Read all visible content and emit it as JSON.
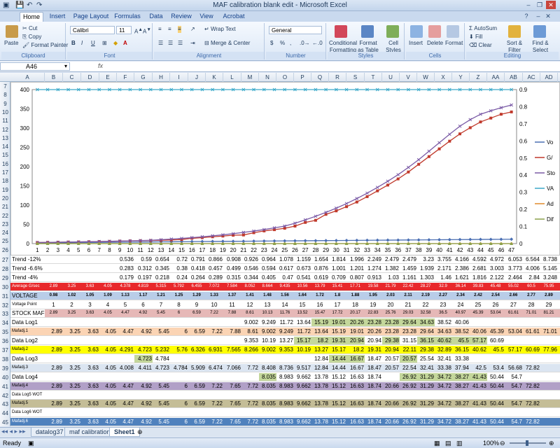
{
  "window": {
    "title": "MAF calibration blank edit - Microsoft Excel"
  },
  "tabs": [
    "Home",
    "Insert",
    "Page Layout",
    "Formulas",
    "Data",
    "Review",
    "View",
    "Acrobat"
  ],
  "ribbon": {
    "clipboard": {
      "paste": "Paste",
      "cut": "Cut",
      "copy": "Copy",
      "format_painter": "Format Painter",
      "label": "Clipboard"
    },
    "font": {
      "name": "Calibri",
      "size": "11",
      "label": "Font",
      "bold": "B",
      "italic": "I",
      "underline": "U"
    },
    "alignment": {
      "wrap": "Wrap Text",
      "merge": "Merge & Center",
      "label": "Alignment"
    },
    "number": {
      "format": "General",
      "currency": "$",
      "percent": "%",
      "comma": ",",
      "label": "Number"
    },
    "styles": {
      "conditional": "Conditional Formatting",
      "format_table": "Format as Table",
      "cell_styles": "Cell Styles",
      "label": "Styles"
    },
    "cells": {
      "insert": "Insert",
      "delete": "Delete",
      "format": "Format",
      "label": "Cells"
    },
    "editing": {
      "autosum": "AutoSum",
      "fill": "Fill",
      "clear": "Clear",
      "sort": "Sort & Filter",
      "find": "Find & Select",
      "label": "Editing"
    }
  },
  "formula_bar": {
    "name_box": "A46",
    "fx": "fx",
    "value": ""
  },
  "columns": [
    "A",
    "B",
    "C",
    "D",
    "E",
    "F",
    "G",
    "H",
    "I",
    "J",
    "K",
    "L",
    "M",
    "N",
    "O",
    "P",
    "Q",
    "R",
    "S",
    "T",
    "U",
    "V",
    "W",
    "X",
    "Y",
    "Z",
    "AA",
    "AB",
    "AC",
    "AD"
  ],
  "chart_rows": [
    "7",
    "8",
    "9",
    "10",
    "11",
    "12",
    "13",
    "14",
    "15",
    "16",
    "17",
    "18",
    "19",
    "20",
    "21",
    "22",
    "23",
    "24",
    "25",
    "26"
  ],
  "chart_data": {
    "type": "line",
    "x": [
      1,
      2,
      3,
      4,
      5,
      6,
      7,
      8,
      9,
      10,
      11,
      12,
      13,
      14,
      15,
      16,
      17,
      18,
      19,
      20,
      21,
      22,
      23,
      24,
      25,
      26,
      27,
      28,
      29,
      30,
      31,
      32,
      33,
      34,
      35,
      36,
      37,
      38,
      39,
      40,
      41,
      42,
      43,
      44,
      45,
      46,
      47
    ],
    "y_left_ticks": [
      "0",
      "50",
      "100",
      "150",
      "200",
      "250",
      "300",
      "350",
      "400"
    ],
    "y_right_ticks": [
      "0",
      "0.1",
      "0.2",
      "0.3",
      "0.4",
      "0.5",
      "0.6",
      "0.7",
      "0.8",
      "0.9"
    ],
    "ylim_left": [
      0,
      400
    ],
    "ylim_right": [
      0,
      0.9
    ],
    "series": [
      {
        "name": "Vo",
        "color": "#4a6fb3",
        "marker": "diamond",
        "axis": "left",
        "values": [
          1.5,
          1.8,
          2,
          2.2,
          2.5,
          2.8,
          3,
          3.2,
          3.5,
          3.7,
          4,
          4.2,
          4.5,
          4.7,
          5,
          5.2,
          5.4,
          5.6,
          5.8,
          6,
          6.2,
          6.4,
          6.6,
          6.8,
          7,
          7.2,
          7.4,
          7.6,
          7.8,
          8,
          8.2,
          8.4,
          8.6,
          8.8,
          9,
          9.2,
          9.4,
          9.6,
          9.8,
          10,
          10.2,
          10.4,
          10.6,
          10.8,
          11,
          11.2,
          11.4
        ]
      },
      {
        "name": "G/",
        "color": "#c0392b",
        "marker": "square",
        "axis": "left",
        "values": [
          2.89,
          3.25,
          3.63,
          4.05,
          4.378,
          4.819,
          5.315,
          5.792,
          6.455,
          7.072,
          7.584,
          8.052,
          8.664,
          9.435,
          10.56,
          13.79,
          15.41,
          17.71,
          19.58,
          21.79,
          22.42,
          28.27,
          32.9,
          36.14,
          39.83,
          45.48,
          55.02,
          60.5,
          75.95,
          85,
          96,
          108,
          122,
          137,
          152,
          168,
          186,
          206,
          226,
          246,
          266,
          285,
          301,
          316,
          326,
          336,
          342
        ]
      },
      {
        "name": "Sto",
        "color": "#7a5aa6",
        "marker": "x",
        "axis": "left",
        "values": [
          2.89,
          3.25,
          3.63,
          4.05,
          4.47,
          4.92,
          5.45,
          6,
          6.59,
          7.22,
          7.88,
          8.61,
          10.13,
          11.76,
          13.52,
          15.47,
          17.72,
          20.17,
          22.83,
          25.76,
          29.03,
          32.58,
          36.5,
          40.97,
          45.39,
          53.04,
          61.61,
          71.01,
          81.21,
          92,
          104,
          117,
          131,
          146,
          162,
          179,
          198,
          218,
          240,
          262,
          284,
          305,
          322,
          336,
          345,
          353,
          360
        ]
      },
      {
        "name": "VA",
        "color": "#3aa9c9",
        "marker": "x",
        "axis": "right",
        "values": [
          0.98,
          0.98,
          0.99,
          0.99,
          1.0,
          1.0,
          1.0,
          1.0,
          1.01,
          1.01,
          1.01,
          1.02,
          1.02,
          1.02,
          1.03,
          1.03,
          1.03,
          1.04,
          1.04,
          1.04,
          1.05,
          1.05,
          1.05,
          1.06,
          1.06,
          1.06,
          1.07,
          1.07,
          1.07,
          1.08,
          1.08,
          1.08,
          1.09,
          1.09,
          1.09,
          1.1,
          1.1,
          1.1,
          1.11,
          1.11,
          1.11,
          1.12,
          1.12,
          1.12,
          1.13,
          1.13,
          1.13
        ]
      },
      {
        "name": "Ad",
        "color": "#e08a2a",
        "marker": "circle",
        "axis": "left",
        "values": [
          0,
          0,
          0,
          0,
          0,
          0,
          0,
          0,
          0,
          0,
          0,
          0,
          0,
          0,
          0,
          0,
          0,
          0,
          0,
          0,
          0,
          0,
          0,
          0,
          0,
          0,
          0,
          0,
          0,
          0,
          0,
          0,
          0,
          0,
          0,
          0,
          0,
          0,
          0,
          0,
          0,
          0,
          0,
          0,
          0,
          0,
          0
        ]
      },
      {
        "name": "Dif",
        "color": "#8aa14a",
        "marker": "triangle",
        "axis": "left",
        "values": [
          0,
          0,
          0,
          0,
          0,
          0,
          0,
          0,
          0,
          0,
          0,
          0,
          0,
          0,
          0,
          0,
          0,
          0,
          0,
          0,
          0,
          0,
          0,
          0,
          0,
          0,
          0,
          0,
          0,
          0,
          0,
          0,
          0,
          0,
          0,
          0,
          0,
          0,
          0,
          0,
          0,
          0,
          0,
          0,
          0,
          0,
          0
        ]
      }
    ]
  },
  "grid": [
    {
      "row": "27",
      "label": "Trend -12%",
      "bg": "#ffffff",
      "label_bg": "#ffffff",
      "start": 5,
      "cells": [
        "0.536",
        "0.59",
        "0.654",
        "0.72",
        "0.791",
        "0.866",
        "0.908",
        "0.926",
        "0.964",
        "1.078",
        "1.159",
        "1.654",
        "1.814",
        "1.996",
        "2.249",
        "2.479",
        "2.479",
        "3.23",
        "3.755",
        "4.166",
        "4.592",
        "4.972",
        "6.053",
        "6.564",
        "8.738"
      ]
    },
    {
      "row": "28",
      "label": "Trend -6.6%",
      "bg": "#ffffff",
      "label_bg": "#ffffff",
      "start": 5,
      "cells": [
        "0.283",
        "0.312",
        "0.345",
        "0.38",
        "0.418",
        "0.457",
        "0.499",
        "0.546",
        "0.594",
        "0.617",
        "0.673",
        "0.876",
        "1.001",
        "1.201",
        "1.274",
        "1.382",
        "1.459",
        "1.939",
        "2.171",
        "2.386",
        "2.681",
        "3.003",
        "3.773",
        "4.006",
        "5.145"
      ]
    },
    {
      "row": "29",
      "label": "Trend -4%",
      "bg": "#ffffff",
      "label_bg": "#ffffff",
      "start": 5,
      "cells": [
        "0.179",
        "0.197",
        "0.218",
        "0.24",
        "0.264",
        "0.289",
        "0.315",
        "0.344",
        "0.405",
        "0.47",
        "0.541",
        "0.619",
        "0.709",
        "0.807",
        "0.913",
        "1.03",
        "1.161",
        "1.303",
        "1.46",
        "1.621",
        "1.816",
        "2.122",
        "2.464",
        "2.84",
        "3.248"
      ]
    },
    {
      "row": "30",
      "label": "Average G/sec",
      "bg": "#e8282b",
      "label_bg": "#e8282b",
      "color": "#ffffff",
      "start": 1,
      "small_label": true,
      "cells": [
        "2.89",
        "3.25",
        "3.63",
        "4.05",
        "4.378",
        "4.819",
        "5.315",
        "5.792",
        "6.455",
        "7.072",
        "7.584",
        "8.052",
        "8.664",
        "9.435",
        "10.56",
        "13.79",
        "15.41",
        "17.71",
        "19.58",
        "21.79",
        "22.42",
        "28.27",
        "32.9",
        "36.14",
        "39.83",
        "45.48",
        "55.02",
        "60.5",
        "75.95"
      ]
    },
    {
      "row": "31",
      "label": "VOLTAGE",
      "bg": "#b9cde8",
      "label_bg": "#b9cde8",
      "start": 1,
      "cells": [
        "0.98",
        "1.02",
        "1.05",
        "1.09",
        "1.13",
        "1.17",
        "1.21",
        "1.25",
        "1.29",
        "1.33",
        "1.37",
        "1.41",
        "1.48",
        "1.56",
        "1.64",
        "1.72",
        "1.8",
        "1.88",
        "1.95",
        "2.03",
        "2.11",
        "2.19",
        "2.27",
        "2.34",
        "2.42",
        "2.54",
        "2.66",
        "2.77",
        "2.89"
      ]
    },
    {
      "row": "32",
      "label": "Voltage Point",
      "bg": "#ffffff",
      "label_bg": "#ffffff",
      "start": 1,
      "small_label": true,
      "cells": [
        "1",
        "2",
        "3",
        "4",
        "5",
        "6",
        "7",
        "8",
        "9",
        "10",
        "11",
        "12",
        "13",
        "14",
        "15",
        "16",
        "17",
        "18",
        "19",
        "20",
        "21",
        "22",
        "23",
        "24",
        "25",
        "26",
        "27",
        "28",
        "29"
      ]
    },
    {
      "row": "33",
      "label": "STOCK MAF",
      "bg": "#e6b8b7",
      "label_bg": "#ffffff",
      "start": 1,
      "cells": [
        "2.89",
        "3.25",
        "3.63",
        "4.05",
        "4.47",
        "4.92",
        "5.45",
        "6",
        "6.59",
        "7.22",
        "7.88",
        "8.61",
        "10.13",
        "11.76",
        "13.52",
        "15.47",
        "17.72",
        "20.17",
        "22.83",
        "25.76",
        "29.03",
        "32.58",
        "36.5",
        "40.97",
        "45.39",
        "53.04",
        "61.61",
        "71.01",
        "81.21"
      ]
    },
    {
      "row": "34",
      "label": "Data Log1",
      "bg": "#ffffff",
      "label_bg": "#ffffff",
      "start": 12,
      "cells": [
        "9.002",
        "9.249",
        "11.72",
        "13.64",
        "15.19",
        "19.01",
        "20.26",
        "23.28",
        "23.28",
        "29.64",
        "34.63",
        "38.52",
        "40.06"
      ],
      "green": [
        4,
        5,
        6,
        7,
        8,
        9,
        10
      ]
    },
    {
      "row": "35",
      "label": "Mafadj.1",
      "bg": "#fbd4b4",
      "label_bg": "#fbd4b4",
      "start": 1,
      "small_label": true,
      "cells": [
        "2.89",
        "3.25",
        "3.63",
        "4.05",
        "4.47",
        "4.92",
        "5.45",
        "6",
        "6.59",
        "7.22",
        "7.88",
        "8.61",
        "9.002",
        "9.249",
        "11.72",
        "13.64",
        "15.19",
        "19.01",
        "20.26",
        "23.28",
        "23.28",
        "29.64",
        "34.63",
        "38.52",
        "40.06",
        "45.39",
        "53.04",
        "61.61",
        "71.01"
      ]
    },
    {
      "row": "36",
      "label": "Data Log2",
      "bg": "#ffffff",
      "label_bg": "#ffffff",
      "start": 12,
      "cells": [
        "9.353",
        "10.19",
        "13.27",
        "15.17",
        "18.2",
        "19.31",
        "20.94",
        "20.94",
        "29.38",
        "31.15",
        "36.15",
        "40.62",
        "45.5",
        "57.17",
        "60.69"
      ],
      "green": [
        3,
        4,
        5,
        6,
        8,
        10,
        11,
        12,
        13
      ]
    },
    {
      "row": "37",
      "label": "Mafadj.2",
      "bg": "#ffff00",
      "label_bg": "#ffff00",
      "start": 1,
      "small_label": true,
      "cells": [
        "2.89",
        "3.25",
        "3.63",
        "4.05",
        "4.291",
        "4.723",
        "5.232",
        "5.76",
        "6.326",
        "6.931",
        "7.565",
        "8.266",
        "9.002",
        "9.353",
        "10.19",
        "13.27",
        "15.17",
        "18.2",
        "19.31",
        "20.94",
        "22.11",
        "29.38",
        "32.89",
        "36.15",
        "40.62",
        "45.5",
        "57.17",
        "60.69",
        "77.96"
      ]
    },
    {
      "row": "38",
      "label": "Data Log3",
      "bg": "#ffffff",
      "label_bg": "#ffffff",
      "start": 6,
      "cells": [
        "4.723",
        "4.784",
        "",
        "",
        "",
        "",
        "",
        "",
        "",
        "",
        "12.84",
        "14.44",
        "16.67",
        "18.47",
        "20.57",
        "20.57",
        "25.54",
        "32.41",
        "33.38"
      ],
      "green": [
        0,
        11,
        12,
        15
      ]
    },
    {
      "row": "39",
      "label": "Mafadj.3",
      "bg": "#dbe5f1",
      "label_bg": "#dbe5f1",
      "start": 1,
      "small_label": true,
      "cells": [
        "2.89",
        "3.25",
        "3.63",
        "4.05",
        "4.008",
        "4.411",
        "4.723",
        "4.784",
        "5.909",
        "6.474",
        "7.066",
        "7.72",
        "8.408",
        "8.736",
        "9.517",
        "12.84",
        "14.44",
        "16.67",
        "18.47",
        "20.57",
        "22.54",
        "32.41",
        "33.38",
        "37.94",
        "42.5",
        "53.4",
        "56.68",
        "72.82"
      ]
    },
    {
      "row": "40",
      "label": "Data Log4",
      "bg": "#ffffff",
      "label_bg": "#ffffff",
      "start": 13,
      "cells": [
        "8.035",
        "8.983",
        "9.662",
        "13.78",
        "15.12",
        "16.63",
        "18.74",
        "",
        "26.92",
        "31.29",
        "34.72",
        "38.27",
        "41.43",
        "50.44",
        "54.7"
      ],
      "green": [
        0,
        8,
        9,
        10,
        11,
        12
      ]
    },
    {
      "row": "41",
      "label": "Mafadj.4",
      "bg": "#b1a0c7",
      "label_bg": "#b1a0c7",
      "start": 1,
      "small_label": true,
      "cells": [
        "2.89",
        "3.25",
        "3.63",
        "4.05",
        "4.47",
        "4.92",
        "5.45",
        "6",
        "6.59",
        "7.22",
        "7.65",
        "7.72",
        "8.035",
        "8.983",
        "9.662",
        "13.78",
        "15.12",
        "16.63",
        "18.74",
        "20.66",
        "26.92",
        "31.29",
        "34.72",
        "38.27",
        "41.43",
        "50.44",
        "54.7",
        "72.82"
      ]
    },
    {
      "row": "42",
      "label": "Data Log5 WOT",
      "bg": "#ffffff",
      "label_bg": "#ffffff",
      "start": 1,
      "small_label": true,
      "cells": []
    },
    {
      "row": "43",
      "label": "Mafadj.5",
      "bg": "#c4bd97",
      "label_bg": "#c4bd97",
      "start": 1,
      "small_label": true,
      "cells": [
        "2.89",
        "3.25",
        "3.63",
        "4.05",
        "4.47",
        "4.92",
        "5.45",
        "6",
        "6.59",
        "7.22",
        "7.65",
        "7.72",
        "8.035",
        "8.983",
        "9.662",
        "13.78",
        "15.12",
        "16.63",
        "18.74",
        "20.66",
        "26.92",
        "31.29",
        "34.72",
        "38.27",
        "41.43",
        "50.44",
        "54.7",
        "72.82"
      ]
    },
    {
      "row": "44",
      "label": "Data Log6 WOT",
      "bg": "#ffffff",
      "label_bg": "#ffffff",
      "start": 1,
      "small_label": true,
      "cells": []
    },
    {
      "row": "45",
      "label": "Mafadj.6",
      "bg": "#4f81bd",
      "label_bg": "#4f81bd",
      "color": "#ffffff",
      "start": 1,
      "small_label": true,
      "cells": [
        "2.89",
        "3.25",
        "3.63",
        "4.05",
        "4.47",
        "4.92",
        "5.45",
        "6",
        "6.59",
        "7.22",
        "7.65",
        "7.72",
        "8.035",
        "8.983",
        "9.662",
        "13.78",
        "15.12",
        "16.63",
        "18.74",
        "20.66",
        "26.92",
        "31.29",
        "34.72",
        "38.27",
        "41.43",
        "50.44",
        "54.7",
        "72.82"
      ]
    },
    {
      "row": "46",
      "label": "",
      "bg": "#ffffff",
      "label_bg": "#ffffff",
      "start": 1,
      "cells": []
    }
  ],
  "sheet_tabs": [
    "datalog37",
    "maf calibration",
    "Sheet1"
  ],
  "active_sheet": "Sheet1",
  "status": {
    "ready": "Ready",
    "zoom": "100%"
  }
}
